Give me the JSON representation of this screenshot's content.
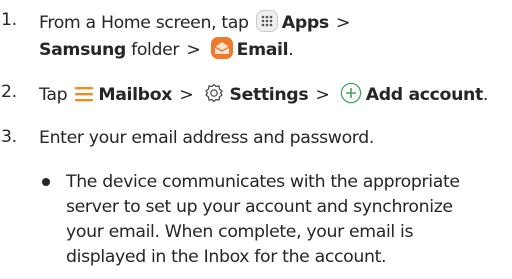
{
  "steps": [
    {
      "number": "1.",
      "from_text": "From a Home screen, tap",
      "apps_label": "Apps",
      "separator": ">",
      "samsung_label": "Samsung",
      "folder_text": "folder",
      "email_label": "Email",
      "end_text": "."
    },
    {
      "number": "2.",
      "tap_text": "Tap",
      "mailbox_label": "Mailbox",
      "settings_label": "Settings",
      "add_account_label": "Add account",
      "end_text": "."
    },
    {
      "number": "3.",
      "text": "Enter your email address and password."
    }
  ],
  "note": {
    "lines": [
      "The device communicates with the appropriate",
      "server to set up your account and synchronize",
      "your email. When complete, your email is",
      "displayed in the Inbox for the account."
    ]
  },
  "icons": {
    "apps": "apps-grid-icon",
    "email": "email-app-icon",
    "mailbox": "hamburger-menu-icon",
    "settings": "settings-gear-icon",
    "add": "add-circle-icon"
  },
  "colors": {
    "text": "#262626",
    "mailbox_icon": "#f28a1c",
    "add_icon": "#3aa85e",
    "email_icon_bg": "#f07a2b",
    "email_icon_paper": "#fbe5cf"
  }
}
